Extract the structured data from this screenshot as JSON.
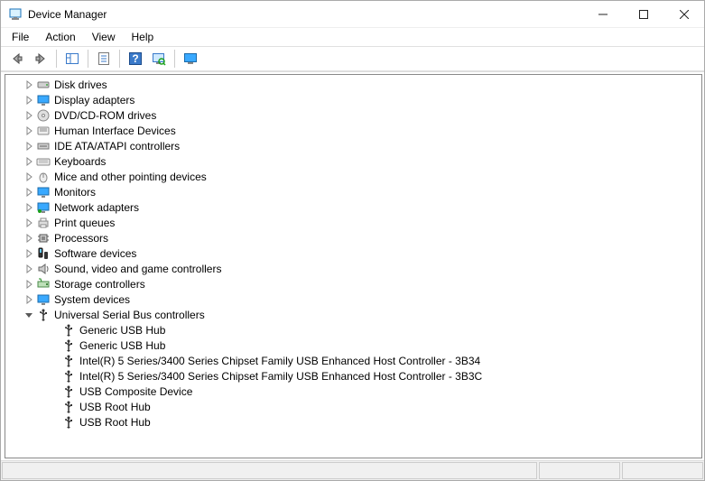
{
  "window": {
    "title": "Device Manager"
  },
  "menu": {
    "file": "File",
    "action": "Action",
    "view": "View",
    "help": "Help"
  },
  "tree": {
    "nodes": [
      {
        "label": "Disk drives",
        "icon": "disk",
        "expanded": false
      },
      {
        "label": "Display adapters",
        "icon": "display",
        "expanded": false
      },
      {
        "label": "DVD/CD-ROM drives",
        "icon": "dvd",
        "expanded": false
      },
      {
        "label": "Human Interface Devices",
        "icon": "hid",
        "expanded": false
      },
      {
        "label": "IDE ATA/ATAPI controllers",
        "icon": "ide",
        "expanded": false
      },
      {
        "label": "Keyboards",
        "icon": "keyboard",
        "expanded": false
      },
      {
        "label": "Mice and other pointing devices",
        "icon": "mouse",
        "expanded": false
      },
      {
        "label": "Monitors",
        "icon": "monitor",
        "expanded": false
      },
      {
        "label": "Network adapters",
        "icon": "network",
        "expanded": false
      },
      {
        "label": "Print queues",
        "icon": "printer",
        "expanded": false
      },
      {
        "label": "Processors",
        "icon": "cpu",
        "expanded": false
      },
      {
        "label": "Software devices",
        "icon": "software",
        "expanded": false
      },
      {
        "label": "Sound, video and game controllers",
        "icon": "sound",
        "expanded": false
      },
      {
        "label": "Storage controllers",
        "icon": "storage",
        "expanded": false
      },
      {
        "label": "System devices",
        "icon": "system",
        "expanded": false
      },
      {
        "label": "Universal Serial Bus controllers",
        "icon": "usb",
        "expanded": true,
        "children": [
          {
            "label": "Generic USB Hub"
          },
          {
            "label": "Generic USB Hub"
          },
          {
            "label": "Intel(R) 5 Series/3400 Series Chipset Family USB Enhanced Host Controller - 3B34"
          },
          {
            "label": "Intel(R) 5 Series/3400 Series Chipset Family USB Enhanced Host Controller - 3B3C"
          },
          {
            "label": "USB Composite Device"
          },
          {
            "label": "USB Root Hub"
          },
          {
            "label": "USB Root Hub"
          }
        ]
      }
    ]
  }
}
